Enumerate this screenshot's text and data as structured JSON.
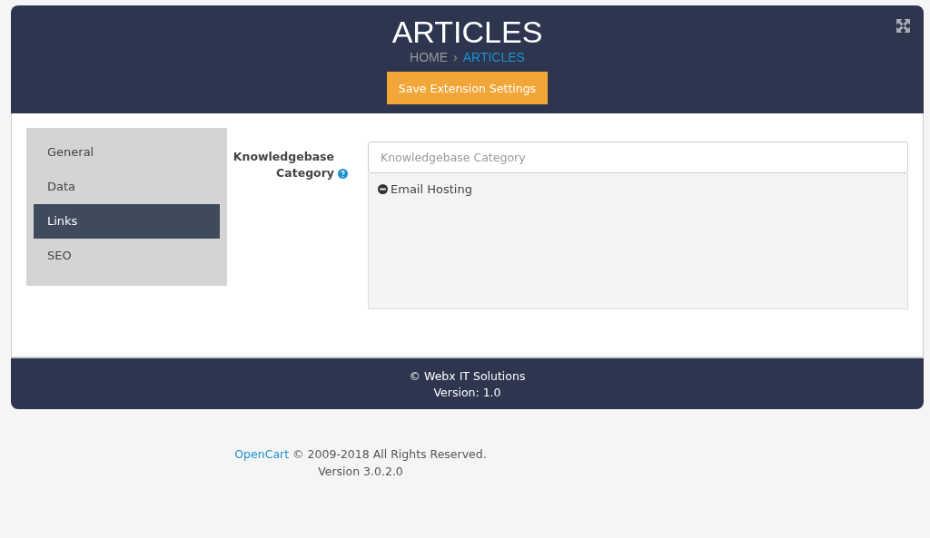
{
  "header": {
    "title": "ARTICLES",
    "breadcrumb": [
      {
        "label": "HOME",
        "selected": false
      },
      {
        "label": "ARTICLES",
        "selected": true
      }
    ],
    "separator": "›",
    "save_button": "Save Extension Settings"
  },
  "sidebar": {
    "items": [
      {
        "label": "General",
        "selected": false
      },
      {
        "label": "Data",
        "selected": false
      },
      {
        "label": "Links",
        "selected": true
      },
      {
        "label": "SEO",
        "selected": false
      }
    ]
  },
  "form": {
    "label": "Knowledgebase Category",
    "field": {
      "placeholder": "Knowledgebase Category"
    },
    "selected_items": [
      "Email Hosting"
    ]
  },
  "card_footer": {
    "copyright": "© Webx IT Solutions",
    "version": "Version: 1.0"
  },
  "page_footer": {
    "link": "OpenCart",
    "text": "© 2009-2018 All Rights Reserved.",
    "version": "Version 3.0.2.0"
  }
}
